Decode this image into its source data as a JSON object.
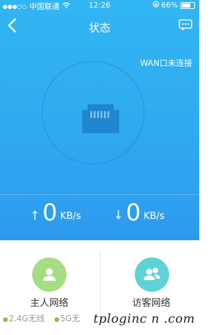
{
  "status_bar": {
    "carrier": "中国联通",
    "time": "12:26",
    "battery": "66%"
  },
  "nav": {
    "title": "状态",
    "back_icon": "chevron-left-icon",
    "message_icon": "chat-bubble-icon"
  },
  "wan_status": "WAN口未连接",
  "speeds": {
    "upload": {
      "value": "0",
      "unit": "KB/s"
    },
    "download": {
      "value": "0",
      "unit": "KB/s"
    }
  },
  "networks": [
    {
      "label": "主人网络",
      "icon": "user-icon",
      "color": "#a7dd82"
    },
    {
      "label": "访客网络",
      "icon": "users-icon",
      "color": "#5ed2d5"
    }
  ],
  "bands": [
    "2.4G无线",
    "5G无"
  ],
  "watermark": "tploginc n .com",
  "colors": {
    "header_top": "#32b6f3",
    "header_bottom": "#2d9aee"
  }
}
